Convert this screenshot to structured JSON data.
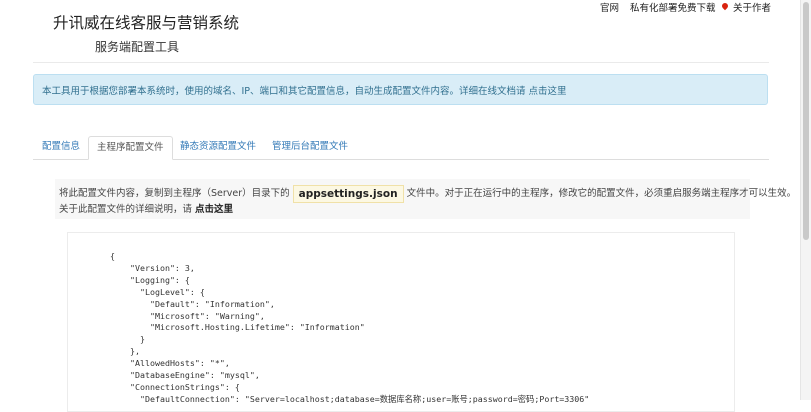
{
  "header": {
    "title": "升讯威在线客服与营销系统",
    "subtitle": "服务端配置工具",
    "nav": {
      "official": "官网",
      "private_deploy": "私有化部署免费下载",
      "about": "关于作者"
    }
  },
  "alert": {
    "text": "本工具用于根据您部署本系统时，使用的域名、IP、端口和其它配置信息，自动生成配置文件内容。详细在线文档请",
    "link": "点击这里"
  },
  "tabs": [
    "配置信息",
    "主程序配置文件",
    "静态资源配置文件",
    "管理后台配置文件"
  ],
  "description": {
    "before": "将此配置文件内容，复制到主程序（Server）目录下的",
    "filename": "appsettings.json",
    "after": "文件中。对于正在运行中的主程序，修改它的配置文件，必须重启服务端主程序才可以生效。",
    "line2": "关于此配置文件的详细说明，请",
    "line2_link": "点击这里"
  },
  "code_lines": [
    "{",
    "    \"Version\": 3,",
    "    \"Logging\": {",
    "      \"LogLevel\": {",
    "        \"Default\": \"Information\",",
    "        \"Microsoft\": \"Warning\",",
    "        \"Microsoft.Hosting.Lifetime\": \"Information\"",
    "      }",
    "    },",
    "    \"AllowedHosts\": \"*\",",
    "    \"DatabaseEngine\": \"mysql\",",
    "    \"ConnectionStrings\": {",
    "      \"DefaultConnection\": \"Server=localhost;database=数据库名称;user=账号;password=密码;Port=3306\""
  ],
  "colors": {
    "accent": "#337ab7",
    "alert_bg": "#d9edf7",
    "alert_text": "#31708f"
  },
  "icons": {
    "about": "map-pin-icon"
  }
}
